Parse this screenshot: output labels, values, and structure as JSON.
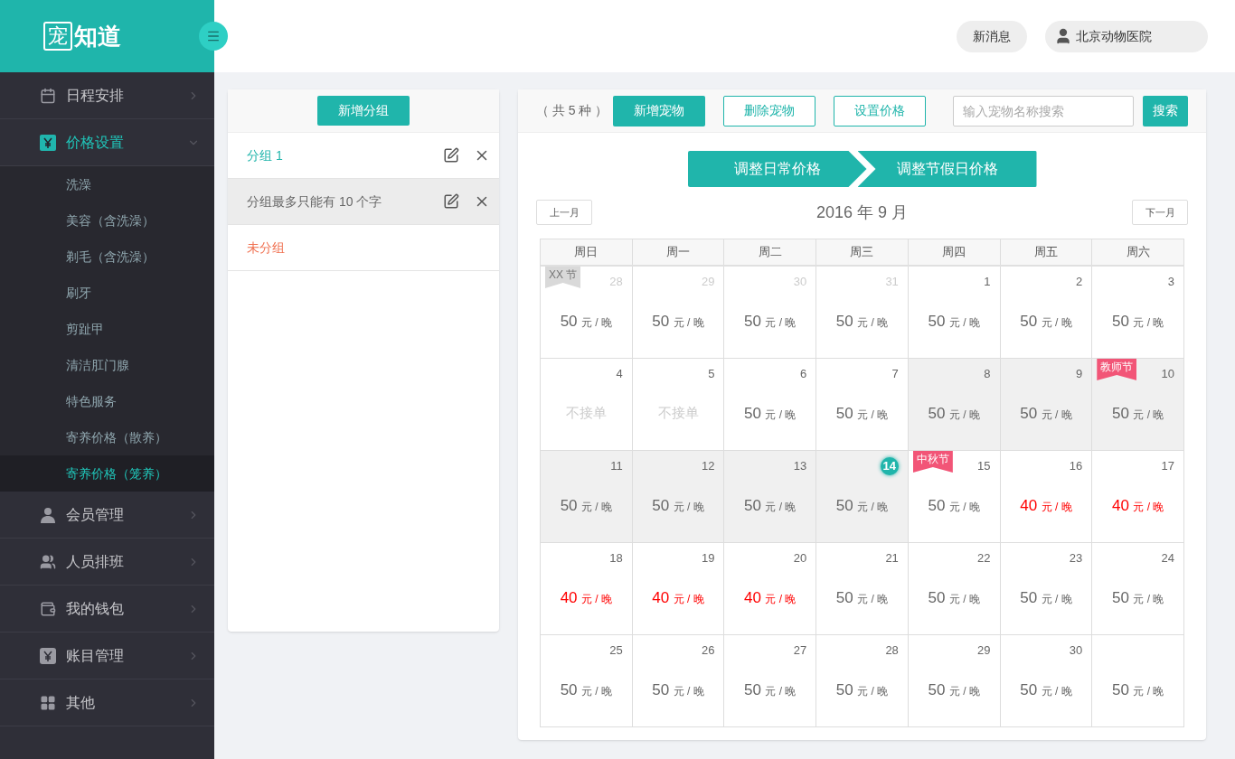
{
  "logo": {
    "mark": "宠",
    "name": "知道"
  },
  "header": {
    "messages_button": "新消息",
    "user": "北京动物医院"
  },
  "sidebar": {
    "items": [
      {
        "label": "日程安排",
        "kind": "calendar",
        "expanded": false,
        "selected": false
      },
      {
        "label": "价格设置",
        "kind": "yen",
        "expanded": true,
        "selected": true,
        "children": [
          {
            "label": "洗澡",
            "selected": false
          },
          {
            "label": "美容（含洗澡）",
            "selected": false
          },
          {
            "label": "剃毛（含洗澡）",
            "selected": false
          },
          {
            "label": "刷牙",
            "selected": false
          },
          {
            "label": "剪趾甲",
            "selected": false
          },
          {
            "label": "清洁肛门腺",
            "selected": false
          },
          {
            "label": "特色服务",
            "selected": false
          },
          {
            "label": "寄养价格（散养）",
            "selected": false
          },
          {
            "label": "寄养价格（笼养）",
            "selected": true
          }
        ]
      },
      {
        "label": "会员管理",
        "kind": "vip",
        "expanded": false,
        "selected": false
      },
      {
        "label": "人员排班",
        "kind": "people",
        "expanded": false,
        "selected": false
      },
      {
        "label": "我的钱包",
        "kind": "wallet",
        "expanded": false,
        "selected": false
      },
      {
        "label": "账目管理",
        "kind": "ledger",
        "expanded": false,
        "selected": false
      },
      {
        "label": "其他",
        "kind": "apps",
        "expanded": false,
        "selected": false
      }
    ]
  },
  "groups": {
    "add_button": "新增分组",
    "items": [
      {
        "label": "分组 1",
        "kind": "group",
        "selected": true,
        "hovered": false
      },
      {
        "label": "分组最多只能有 10 个字",
        "kind": "group",
        "selected": false,
        "hovered": true
      },
      {
        "label": "未分组",
        "kind": "ungrouped"
      }
    ]
  },
  "toolbar": {
    "count": "（ 共 5 种 ）",
    "buttons": [
      {
        "label": "新增宠物",
        "kind": "primary"
      },
      {
        "label": "删除宠物",
        "kind": "outline"
      },
      {
        "label": "设置价格",
        "kind": "outline"
      }
    ],
    "search": {
      "placeholder": "输入宠物名称搜索",
      "button": "搜索"
    }
  },
  "steps": [
    {
      "label": "调整日常价格"
    },
    {
      "label": "调整节假日价格"
    }
  ],
  "calendar": {
    "prev": "上一月",
    "next": "下一月",
    "title": "2016 年 9 月",
    "weekdays": [
      "周日",
      "周一",
      "周二",
      "周三",
      "周四",
      "周五",
      "周六"
    ],
    "weeks": [
      [
        {
          "day": "28",
          "other_month": true,
          "kind": "price",
          "amount": "50",
          "unit": "元 / 晚",
          "discount": false,
          "selected": false,
          "tag": {
            "label": "XX 节",
            "color": "#d9d9d9"
          }
        },
        {
          "day": "29",
          "other_month": true,
          "kind": "price",
          "amount": "50",
          "unit": "元 / 晚",
          "discount": false,
          "selected": false
        },
        {
          "day": "30",
          "other_month": true,
          "kind": "price",
          "amount": "50",
          "unit": "元 / 晚",
          "discount": false,
          "selected": false
        },
        {
          "day": "31",
          "other_month": true,
          "kind": "price",
          "amount": "50",
          "unit": "元 / 晚",
          "discount": false,
          "selected": false
        },
        {
          "day": "1",
          "kind": "price",
          "amount": "50",
          "unit": "元 / 晚",
          "discount": false,
          "selected": false
        },
        {
          "day": "2",
          "kind": "price",
          "amount": "50",
          "unit": "元 / 晚",
          "discount": false,
          "selected": false
        },
        {
          "day": "3",
          "kind": "price",
          "amount": "50",
          "unit": "元 / 晚",
          "discount": false,
          "selected": false
        }
      ],
      [
        {
          "day": "4",
          "kind": "closed",
          "text": "不接单",
          "selected": false
        },
        {
          "day": "5",
          "kind": "closed",
          "text": "不接单",
          "selected": false
        },
        {
          "day": "6",
          "kind": "price",
          "amount": "50",
          "unit": "元 / 晚",
          "discount": false,
          "selected": false
        },
        {
          "day": "7",
          "kind": "price",
          "amount": "50",
          "unit": "元 / 晚",
          "discount": false,
          "selected": false
        },
        {
          "day": "8",
          "kind": "price",
          "amount": "50",
          "unit": "元 / 晚",
          "discount": false,
          "selected": true
        },
        {
          "day": "9",
          "kind": "price",
          "amount": "50",
          "unit": "元 / 晚",
          "discount": false,
          "selected": true
        },
        {
          "day": "10",
          "kind": "price",
          "amount": "50",
          "unit": "元 / 晚",
          "discount": false,
          "selected": true,
          "tag": {
            "label": "教师节",
            "color": "#f25577"
          }
        }
      ],
      [
        {
          "day": "11",
          "kind": "price",
          "amount": "50",
          "unit": "元 / 晚",
          "discount": false,
          "selected": true
        },
        {
          "day": "12",
          "kind": "price",
          "amount": "50",
          "unit": "元 / 晚",
          "discount": false,
          "selected": true
        },
        {
          "day": "13",
          "kind": "price",
          "amount": "50",
          "unit": "元 / 晚",
          "discount": false,
          "selected": true
        },
        {
          "day": "14",
          "kind": "price",
          "amount": "50",
          "unit": "元 / 晚",
          "discount": false,
          "selected": true,
          "today": true
        },
        {
          "day": "15",
          "kind": "price",
          "amount": "50",
          "unit": "元 / 晚",
          "discount": false,
          "selected": false,
          "tag": {
            "label": "中秋节",
            "color": "#f25577"
          }
        },
        {
          "day": "16",
          "kind": "price",
          "amount": "40",
          "unit": "元 / 晚",
          "discount": true,
          "selected": false
        },
        {
          "day": "17",
          "kind": "price",
          "amount": "40",
          "unit": "元 / 晚",
          "discount": true,
          "selected": false
        }
      ],
      [
        {
          "day": "18",
          "kind": "price",
          "amount": "40",
          "unit": "元 / 晚",
          "discount": true,
          "selected": false
        },
        {
          "day": "19",
          "kind": "price",
          "amount": "40",
          "unit": "元 / 晚",
          "discount": true,
          "selected": false
        },
        {
          "day": "20",
          "kind": "price",
          "amount": "40",
          "unit": "元 / 晚",
          "discount": true,
          "selected": false
        },
        {
          "day": "21",
          "kind": "price",
          "amount": "50",
          "unit": "元 / 晚",
          "discount": false,
          "selected": false
        },
        {
          "day": "22",
          "kind": "price",
          "amount": "50",
          "unit": "元 / 晚",
          "discount": false,
          "selected": false
        },
        {
          "day": "23",
          "kind": "price",
          "amount": "50",
          "unit": "元 / 晚",
          "discount": false,
          "selected": false
        },
        {
          "day": "24",
          "kind": "price",
          "amount": "50",
          "unit": "元 / 晚",
          "discount": false,
          "selected": false
        }
      ],
      [
        {
          "day": "25",
          "kind": "price",
          "amount": "50",
          "unit": "元 / 晚",
          "discount": false,
          "selected": false
        },
        {
          "day": "26",
          "kind": "price",
          "amount": "50",
          "unit": "元 / 晚",
          "discount": false,
          "selected": false
        },
        {
          "day": "27",
          "kind": "price",
          "amount": "50",
          "unit": "元 / 晚",
          "discount": false,
          "selected": false
        },
        {
          "day": "28",
          "kind": "price",
          "amount": "50",
          "unit": "元 / 晚",
          "discount": false,
          "selected": false
        },
        {
          "day": "29",
          "kind": "price",
          "amount": "50",
          "unit": "元 / 晚",
          "discount": false,
          "selected": false
        },
        {
          "day": "30",
          "kind": "price",
          "amount": "50",
          "unit": "元 / 晚",
          "discount": false,
          "selected": false
        },
        {
          "kind": "price",
          "amount": "50",
          "unit": "元 / 晚",
          "discount": false,
          "selected": false
        }
      ]
    ]
  }
}
